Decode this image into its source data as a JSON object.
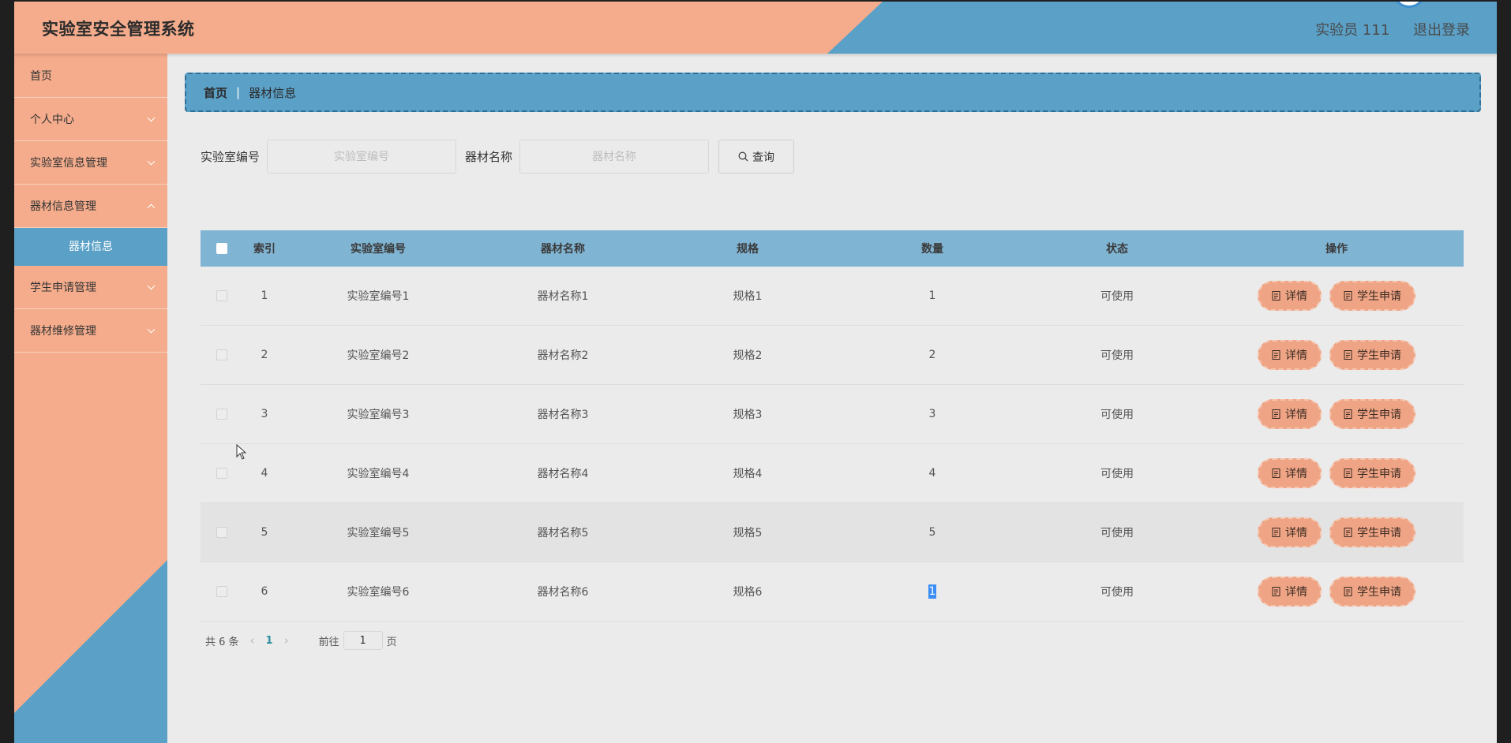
{
  "header": {
    "title": "实验室安全管理系统",
    "user": "实验员 111",
    "logout": "退出登录"
  },
  "colors": {
    "salmon": "#f4ac8c",
    "blue": "#5aa0c7",
    "table_head": "#80b4d3",
    "button": "#eea485"
  },
  "sidebar": {
    "home": "首页",
    "items": [
      {
        "label": "个人中心"
      },
      {
        "label": "实验室信息管理"
      },
      {
        "label": "器材信息管理"
      },
      {
        "label": "学生申请管理"
      },
      {
        "label": "器材维修管理"
      }
    ],
    "active_sub": "器材信息"
  },
  "breadcrumb": {
    "home": "首页",
    "sep": "|",
    "current": "器材信息"
  },
  "search": {
    "lab_label": "实验室编号",
    "lab_placeholder": "实验室编号",
    "name_label": "器材名称",
    "name_placeholder": "器材名称",
    "button": "查询"
  },
  "table": {
    "headers": [
      "索引",
      "实验室编号",
      "器材名称",
      "规格",
      "数量",
      "状态",
      "操作"
    ],
    "rows": [
      {
        "index": "1",
        "lab": "实验室编号1",
        "name": "器材名称1",
        "spec": "规格1",
        "qty": "1",
        "state": "可使用"
      },
      {
        "index": "2",
        "lab": "实验室编号2",
        "name": "器材名称2",
        "spec": "规格2",
        "qty": "2",
        "state": "可使用"
      },
      {
        "index": "3",
        "lab": "实验室编号3",
        "name": "器材名称3",
        "spec": "规格3",
        "qty": "3",
        "state": "可使用"
      },
      {
        "index": "4",
        "lab": "实验室编号4",
        "name": "器材名称4",
        "spec": "规格4",
        "qty": "4",
        "state": "可使用"
      },
      {
        "index": "5",
        "lab": "实验室编号5",
        "name": "器材名称5",
        "spec": "规格5",
        "qty": "5",
        "state": "可使用"
      },
      {
        "index": "6",
        "lab": "实验室编号6",
        "name": "器材名称6",
        "spec": "规格6",
        "qty": "1",
        "state": "可使用"
      }
    ],
    "detail_btn": "详情",
    "apply_btn": "学生申请"
  },
  "pagination": {
    "total": "共 6 条",
    "current": "1",
    "goto_label": "前往",
    "goto_value": "1",
    "page_unit": "页"
  }
}
